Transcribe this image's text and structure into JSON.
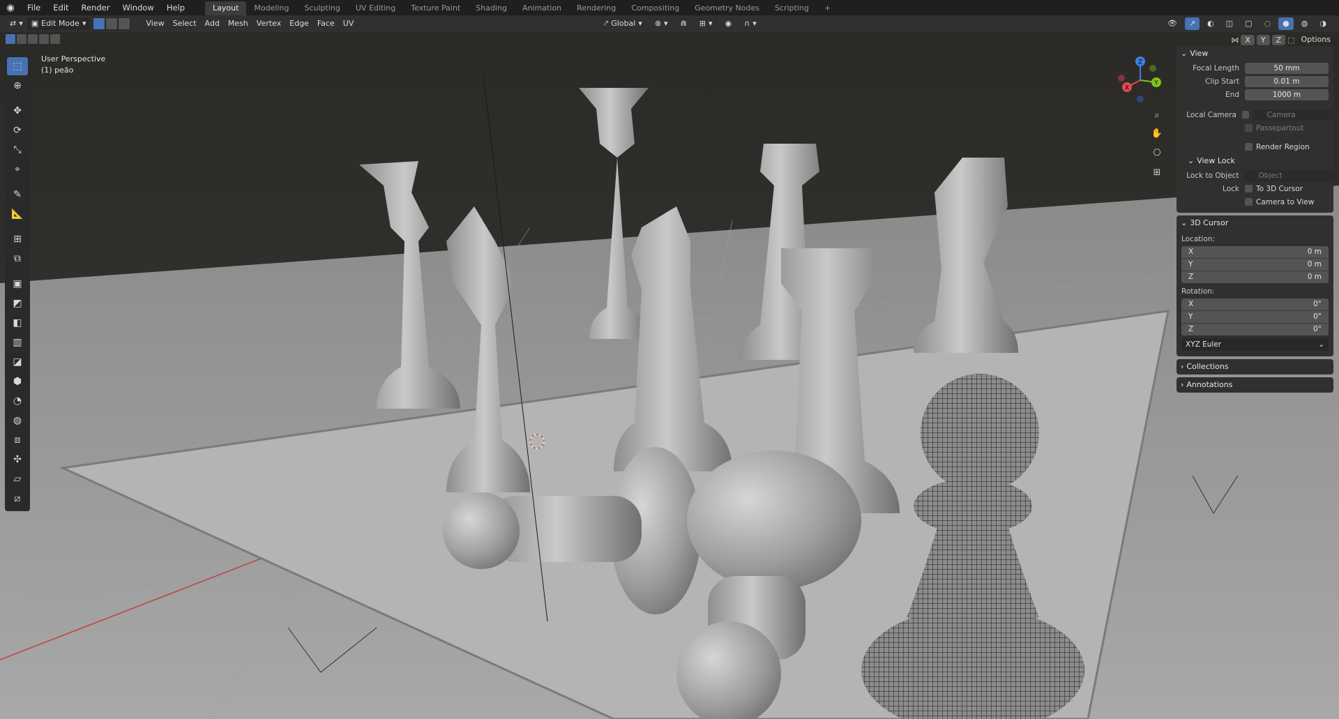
{
  "topbar": {
    "menus": [
      "File",
      "Edit",
      "Render",
      "Window",
      "Help"
    ],
    "workspaces": [
      "Layout",
      "Modeling",
      "Sculpting",
      "UV Editing",
      "Texture Paint",
      "Shading",
      "Animation",
      "Rendering",
      "Compositing",
      "Geometry Nodes",
      "Scripting"
    ],
    "active_workspace": "Layout",
    "add_tab": "+"
  },
  "header": {
    "mode": "Edit Mode",
    "menus": [
      "View",
      "Select",
      "Add",
      "Mesh",
      "Vertex",
      "Edge",
      "Face",
      "UV"
    ],
    "transform_orientation": "Global",
    "options_label": "Options",
    "axes": [
      "X",
      "Y",
      "Z"
    ]
  },
  "viewport": {
    "perspective": "User Perspective",
    "object": "(1) peão",
    "gizmo": {
      "x": "X",
      "y": "Y",
      "z": "Z"
    }
  },
  "toolbar": {
    "tools": [
      "select-box",
      "cursor",
      "move",
      "rotate",
      "scale",
      "transform",
      "annotate",
      "measure",
      "add-cube",
      "extrude-region",
      "inset-faces",
      "bevel",
      "loop-cut",
      "knife",
      "poly-build",
      "spin",
      "smooth",
      "edge-slide",
      "shrink-fatten",
      "shear",
      "rip-region"
    ]
  },
  "npanel": {
    "view": {
      "title": "View",
      "focal_length_label": "Focal Length",
      "focal_length": "50 mm",
      "clip_start_label": "Clip Start",
      "clip_start": "0.01 m",
      "end_label": "End",
      "end": "1000 m",
      "local_camera_label": "Local Camera",
      "camera_placeholder": "Camera",
      "passepartout": "Passepartout",
      "render_region": "Render Region"
    },
    "view_lock": {
      "title": "View Lock",
      "lock_to_object_label": "Lock to Object",
      "object_placeholder": "Object",
      "lock_label": "Lock",
      "to_3d_cursor": "To 3D Cursor",
      "camera_to_view": "Camera to View"
    },
    "cursor": {
      "title": "3D Cursor",
      "location_label": "Location:",
      "location": [
        {
          "axis": "X",
          "value": "0 m"
        },
        {
          "axis": "Y",
          "value": "0 m"
        },
        {
          "axis": "Z",
          "value": "0 m"
        }
      ],
      "rotation_label": "Rotation:",
      "rotation": [
        {
          "axis": "X",
          "value": "0°"
        },
        {
          "axis": "Y",
          "value": "0°"
        },
        {
          "axis": "Z",
          "value": "0°"
        }
      ],
      "rotation_mode": "XYZ Euler"
    },
    "collections": "Collections",
    "annotations": "Annotations"
  },
  "colors": {
    "accent": "#4772b3",
    "x_axis": "#e04b4b",
    "y_axis": "#80c41e",
    "z_axis": "#3d7fe0"
  }
}
